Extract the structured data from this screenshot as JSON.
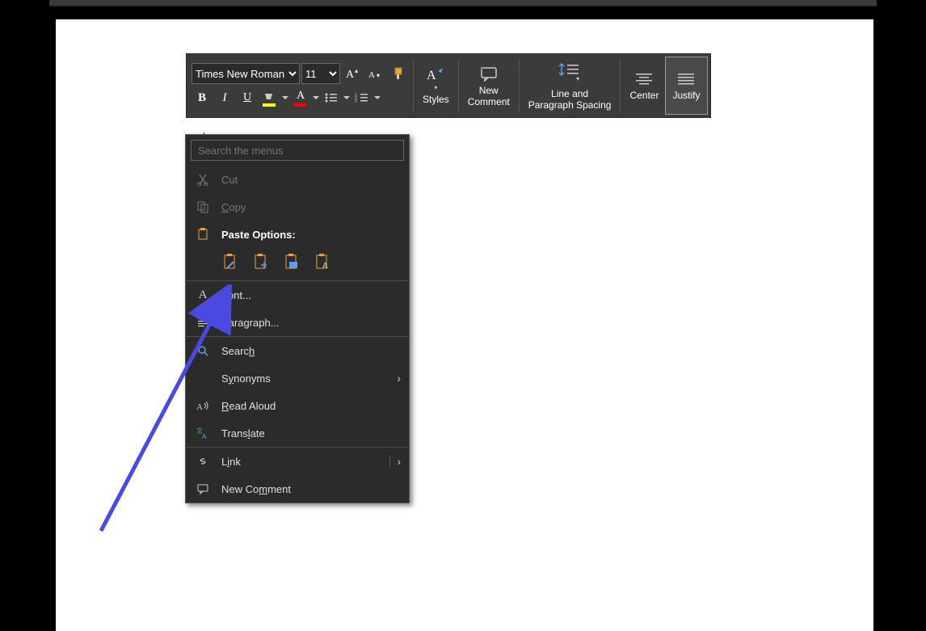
{
  "toolbar": {
    "font_name": "Times New Roman",
    "font_size": "11",
    "styles_label": "Styles",
    "new_comment_label": "New\nComment",
    "line_spacing_label": "Line and\nParagraph Spacing",
    "center_label": "Center",
    "justify_label": "Justify"
  },
  "context_menu": {
    "search_placeholder": "Search the menus",
    "cut": "Cut",
    "copy": "Copy",
    "paste_options": "Paste Options:",
    "font": "Font...",
    "paragraph": "Paragraph...",
    "search": "Search",
    "synonyms": "Synonyms",
    "read_aloud": "Read Aloud",
    "translate": "Translate",
    "link": "Link",
    "new_comment": "New Comment"
  }
}
